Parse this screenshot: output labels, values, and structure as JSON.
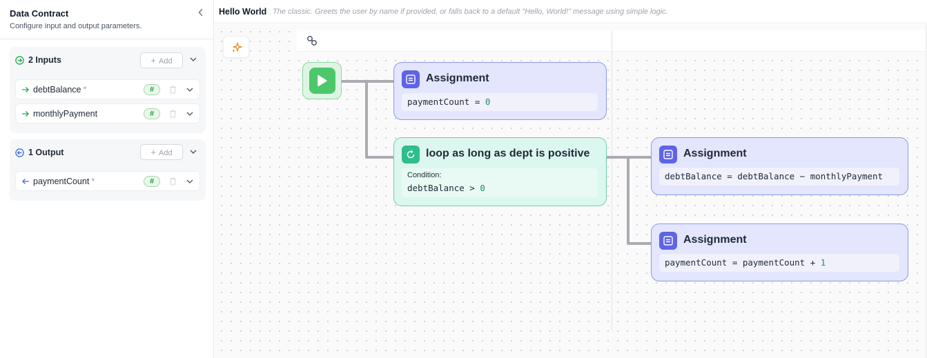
{
  "sidebar": {
    "title": "Data Contract",
    "subtitle": "Configure input and output parameters.",
    "collapse_icon": "chevron-left-icon",
    "inputs": {
      "title": "2 Inputs",
      "add_label": "Add",
      "params": [
        {
          "name": "debtBalance",
          "required": "*",
          "type_badge": "#"
        },
        {
          "name": "monthlyPayment",
          "required": "",
          "type_badge": "#"
        }
      ]
    },
    "outputs": {
      "title": "1 Output",
      "add_label": "Add",
      "params": [
        {
          "name": "paymentCount",
          "required": "*",
          "type_badge": "#"
        }
      ]
    }
  },
  "topbar": {
    "title": "Hello World",
    "description": "The classic. Greets the user by name if provided, or falls back to a default \"Hello, World!\" message using simple logic."
  },
  "canvas": {
    "nodes": {
      "assign1": {
        "title": "Assignment",
        "code_var": "paymentCount = ",
        "code_num": "0"
      },
      "loop": {
        "title": "loop as long as dept is positive",
        "condition_label": "Condition:",
        "code_var": "debtBalance > ",
        "code_num": "0"
      },
      "assign2": {
        "title": "Assignment",
        "code_var": "debtBalance = debtBalance − monthlyPayment",
        "code_num": ""
      },
      "assign3": {
        "title": "Assignment",
        "code_var": "paymentCount = paymentCount + ",
        "code_num": "1"
      }
    }
  },
  "colors": {
    "assign_bg": "#e3e6fd",
    "assign_border": "#8d97ea",
    "assign_icon": "#5f63e6",
    "loop_bg": "#dcf7ef",
    "loop_border": "#6ecfaa",
    "loop_icon": "#2ebd8d",
    "start_green": "#4cc76a",
    "connector": "#a9abb0"
  }
}
